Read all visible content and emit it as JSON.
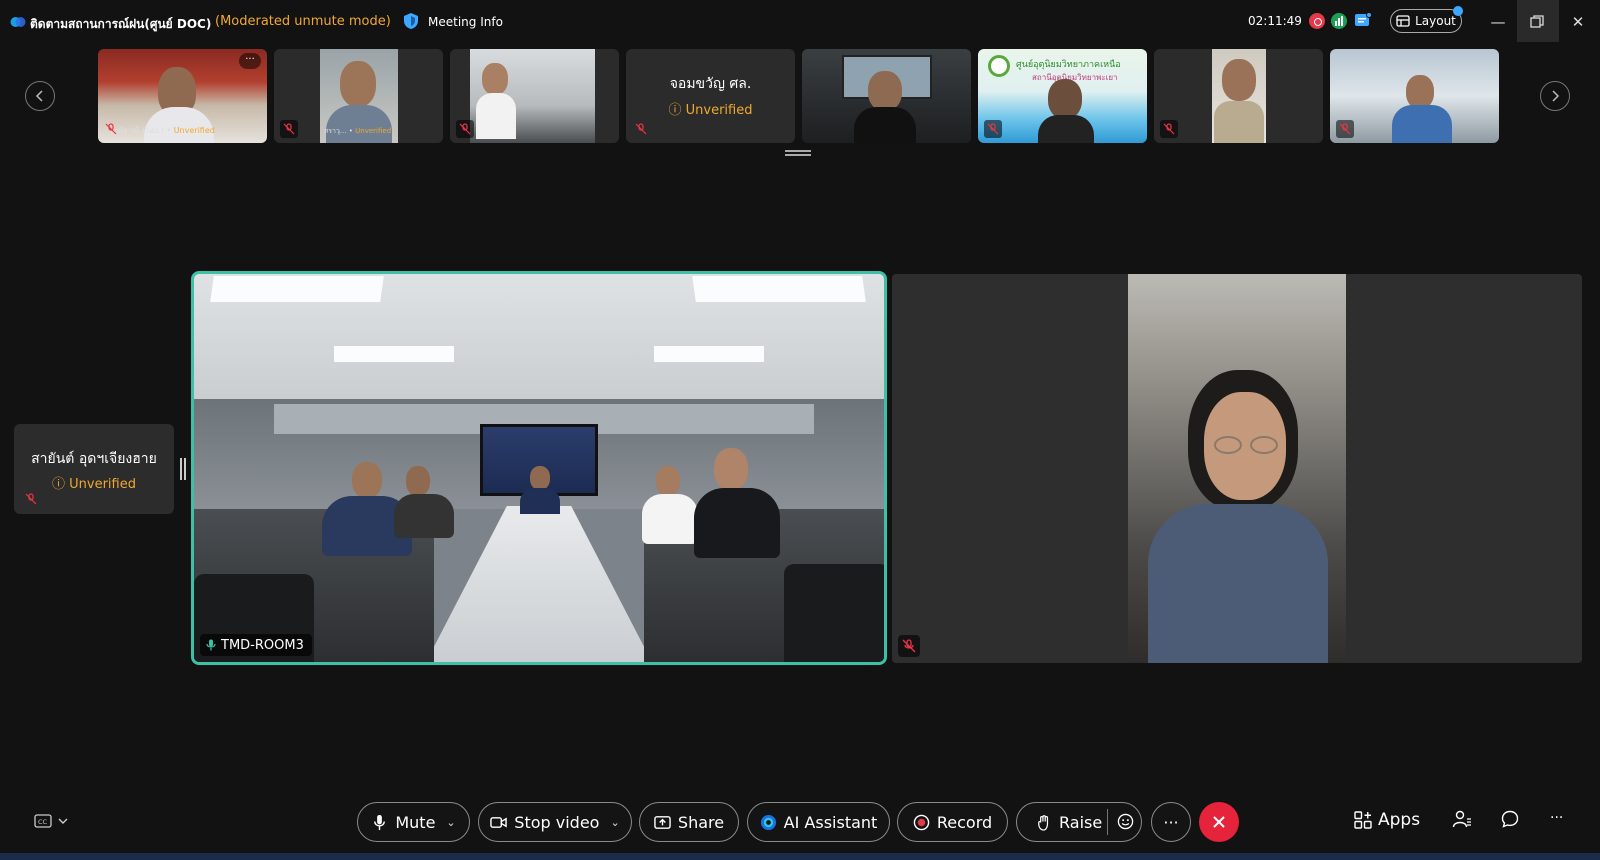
{
  "app": {
    "meeting_title": "ติดตามสถานการณ์ฝน(ศูนย์ DOC)",
    "mode": "(Moderated unmute mode)",
    "meeting_info_label": "Meeting Info",
    "timer": "02:11:49",
    "layout_label": "Layout"
  },
  "filmstrip": {
    "tiles": [
      {
        "caption_name": "ณัฐวุฒิ (รอง.)",
        "caption_status": "Unverified",
        "muted": true,
        "has_more_menu": true
      },
      {
        "caption_name": "สราวุ...",
        "caption_status": "Unverified",
        "muted": true
      },
      {
        "muted": true
      },
      {
        "name": "จอมขวัญ ศล.",
        "status": "Unverified",
        "muted": true,
        "avatar_only": true
      },
      {
        "muted": false
      },
      {
        "banner_text": "ศูนย์อุตุนิยมวิทยาภาคเหนือ",
        "banner_sub": "สถานีอุตุนิยมวิทยาพะเยา",
        "muted": true
      },
      {
        "muted": true
      },
      {
        "muted": true
      }
    ]
  },
  "stage": {
    "side_participant": {
      "name": "สายันต์ อุดฯเจียงฮาย",
      "status": "Unverified"
    },
    "main_video": {
      "name_tag": "TMD-ROOM3",
      "active_speaker": true
    },
    "second_video": {
      "muted": true
    }
  },
  "toolbar": {
    "mute_label": "Mute",
    "stop_video_label": "Stop video",
    "share_label": "Share",
    "ai_label": "AI Assistant",
    "record_label": "Record",
    "raise_label": "Raise",
    "more_label": "···",
    "apps_label": "Apps",
    "overflow_label": "···"
  },
  "colors": {
    "accent_active": "#3cc0a6",
    "unverified": "#f0a830",
    "leave": "#e5243b",
    "mode_text": "#f0a830"
  }
}
